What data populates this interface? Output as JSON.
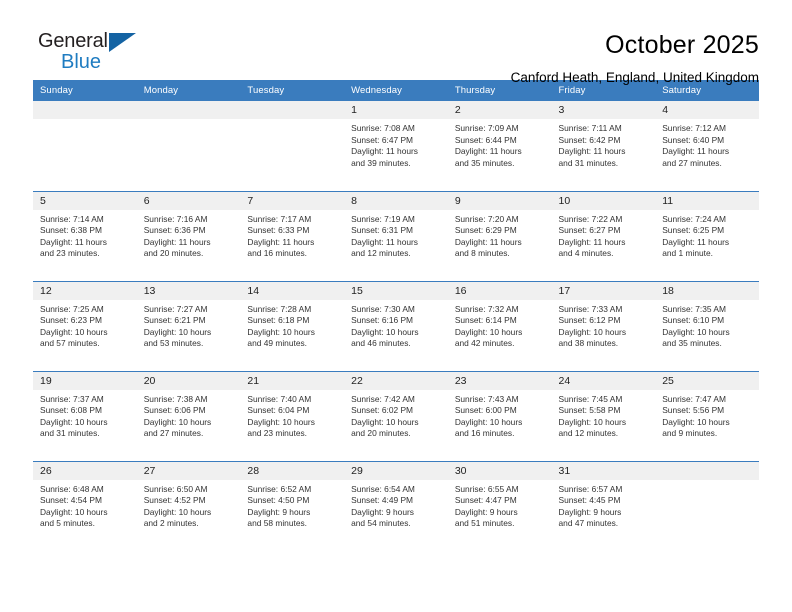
{
  "logo": {
    "word_top": "General",
    "word_bottom": "Blue",
    "triangle_icon": "triangle-icon",
    "accent_dark": "#231f20",
    "accent_blue": "#1f7cc1"
  },
  "header": {
    "title": "October 2025",
    "subtitle": "Canford Heath, England, United Kingdom"
  },
  "theme": {
    "header_row_bg": "#3a7cbe",
    "daynum_bg": "#f0f0f0",
    "grid_line": "#3a7cbe",
    "text": "#333333"
  },
  "weekday_headers": [
    "Sunday",
    "Monday",
    "Tuesday",
    "Wednesday",
    "Thursday",
    "Friday",
    "Saturday"
  ],
  "weeks": [
    [
      {
        "day": "",
        "empty": true
      },
      {
        "day": "",
        "empty": true
      },
      {
        "day": "",
        "empty": true
      },
      {
        "day": "1",
        "sunrise": "Sunrise: 7:08 AM",
        "sunset": "Sunset: 6:47 PM",
        "daylight_1": "Daylight: 11 hours",
        "daylight_2": "and 39 minutes."
      },
      {
        "day": "2",
        "sunrise": "Sunrise: 7:09 AM",
        "sunset": "Sunset: 6:44 PM",
        "daylight_1": "Daylight: 11 hours",
        "daylight_2": "and 35 minutes."
      },
      {
        "day": "3",
        "sunrise": "Sunrise: 7:11 AM",
        "sunset": "Sunset: 6:42 PM",
        "daylight_1": "Daylight: 11 hours",
        "daylight_2": "and 31 minutes."
      },
      {
        "day": "4",
        "sunrise": "Sunrise: 7:12 AM",
        "sunset": "Sunset: 6:40 PM",
        "daylight_1": "Daylight: 11 hours",
        "daylight_2": "and 27 minutes."
      }
    ],
    [
      {
        "day": "5",
        "sunrise": "Sunrise: 7:14 AM",
        "sunset": "Sunset: 6:38 PM",
        "daylight_1": "Daylight: 11 hours",
        "daylight_2": "and 23 minutes."
      },
      {
        "day": "6",
        "sunrise": "Sunrise: 7:16 AM",
        "sunset": "Sunset: 6:36 PM",
        "daylight_1": "Daylight: 11 hours",
        "daylight_2": "and 20 minutes."
      },
      {
        "day": "7",
        "sunrise": "Sunrise: 7:17 AM",
        "sunset": "Sunset: 6:33 PM",
        "daylight_1": "Daylight: 11 hours",
        "daylight_2": "and 16 minutes."
      },
      {
        "day": "8",
        "sunrise": "Sunrise: 7:19 AM",
        "sunset": "Sunset: 6:31 PM",
        "daylight_1": "Daylight: 11 hours",
        "daylight_2": "and 12 minutes."
      },
      {
        "day": "9",
        "sunrise": "Sunrise: 7:20 AM",
        "sunset": "Sunset: 6:29 PM",
        "daylight_1": "Daylight: 11 hours",
        "daylight_2": "and 8 minutes."
      },
      {
        "day": "10",
        "sunrise": "Sunrise: 7:22 AM",
        "sunset": "Sunset: 6:27 PM",
        "daylight_1": "Daylight: 11 hours",
        "daylight_2": "and 4 minutes."
      },
      {
        "day": "11",
        "sunrise": "Sunrise: 7:24 AM",
        "sunset": "Sunset: 6:25 PM",
        "daylight_1": "Daylight: 11 hours",
        "daylight_2": "and 1 minute."
      }
    ],
    [
      {
        "day": "12",
        "sunrise": "Sunrise: 7:25 AM",
        "sunset": "Sunset: 6:23 PM",
        "daylight_1": "Daylight: 10 hours",
        "daylight_2": "and 57 minutes."
      },
      {
        "day": "13",
        "sunrise": "Sunrise: 7:27 AM",
        "sunset": "Sunset: 6:21 PM",
        "daylight_1": "Daylight: 10 hours",
        "daylight_2": "and 53 minutes."
      },
      {
        "day": "14",
        "sunrise": "Sunrise: 7:28 AM",
        "sunset": "Sunset: 6:18 PM",
        "daylight_1": "Daylight: 10 hours",
        "daylight_2": "and 49 minutes."
      },
      {
        "day": "15",
        "sunrise": "Sunrise: 7:30 AM",
        "sunset": "Sunset: 6:16 PM",
        "daylight_1": "Daylight: 10 hours",
        "daylight_2": "and 46 minutes."
      },
      {
        "day": "16",
        "sunrise": "Sunrise: 7:32 AM",
        "sunset": "Sunset: 6:14 PM",
        "daylight_1": "Daylight: 10 hours",
        "daylight_2": "and 42 minutes."
      },
      {
        "day": "17",
        "sunrise": "Sunrise: 7:33 AM",
        "sunset": "Sunset: 6:12 PM",
        "daylight_1": "Daylight: 10 hours",
        "daylight_2": "and 38 minutes."
      },
      {
        "day": "18",
        "sunrise": "Sunrise: 7:35 AM",
        "sunset": "Sunset: 6:10 PM",
        "daylight_1": "Daylight: 10 hours",
        "daylight_2": "and 35 minutes."
      }
    ],
    [
      {
        "day": "19",
        "sunrise": "Sunrise: 7:37 AM",
        "sunset": "Sunset: 6:08 PM",
        "daylight_1": "Daylight: 10 hours",
        "daylight_2": "and 31 minutes."
      },
      {
        "day": "20",
        "sunrise": "Sunrise: 7:38 AM",
        "sunset": "Sunset: 6:06 PM",
        "daylight_1": "Daylight: 10 hours",
        "daylight_2": "and 27 minutes."
      },
      {
        "day": "21",
        "sunrise": "Sunrise: 7:40 AM",
        "sunset": "Sunset: 6:04 PM",
        "daylight_1": "Daylight: 10 hours",
        "daylight_2": "and 23 minutes."
      },
      {
        "day": "22",
        "sunrise": "Sunrise: 7:42 AM",
        "sunset": "Sunset: 6:02 PM",
        "daylight_1": "Daylight: 10 hours",
        "daylight_2": "and 20 minutes."
      },
      {
        "day": "23",
        "sunrise": "Sunrise: 7:43 AM",
        "sunset": "Sunset: 6:00 PM",
        "daylight_1": "Daylight: 10 hours",
        "daylight_2": "and 16 minutes."
      },
      {
        "day": "24",
        "sunrise": "Sunrise: 7:45 AM",
        "sunset": "Sunset: 5:58 PM",
        "daylight_1": "Daylight: 10 hours",
        "daylight_2": "and 12 minutes."
      },
      {
        "day": "25",
        "sunrise": "Sunrise: 7:47 AM",
        "sunset": "Sunset: 5:56 PM",
        "daylight_1": "Daylight: 10 hours",
        "daylight_2": "and 9 minutes."
      }
    ],
    [
      {
        "day": "26",
        "sunrise": "Sunrise: 6:48 AM",
        "sunset": "Sunset: 4:54 PM",
        "daylight_1": "Daylight: 10 hours",
        "daylight_2": "and 5 minutes."
      },
      {
        "day": "27",
        "sunrise": "Sunrise: 6:50 AM",
        "sunset": "Sunset: 4:52 PM",
        "daylight_1": "Daylight: 10 hours",
        "daylight_2": "and 2 minutes."
      },
      {
        "day": "28",
        "sunrise": "Sunrise: 6:52 AM",
        "sunset": "Sunset: 4:50 PM",
        "daylight_1": "Daylight: 9 hours",
        "daylight_2": "and 58 minutes."
      },
      {
        "day": "29",
        "sunrise": "Sunrise: 6:54 AM",
        "sunset": "Sunset: 4:49 PM",
        "daylight_1": "Daylight: 9 hours",
        "daylight_2": "and 54 minutes."
      },
      {
        "day": "30",
        "sunrise": "Sunrise: 6:55 AM",
        "sunset": "Sunset: 4:47 PM",
        "daylight_1": "Daylight: 9 hours",
        "daylight_2": "and 51 minutes."
      },
      {
        "day": "31",
        "sunrise": "Sunrise: 6:57 AM",
        "sunset": "Sunset: 4:45 PM",
        "daylight_1": "Daylight: 9 hours",
        "daylight_2": "and 47 minutes."
      },
      {
        "day": "",
        "empty": true
      }
    ]
  ]
}
